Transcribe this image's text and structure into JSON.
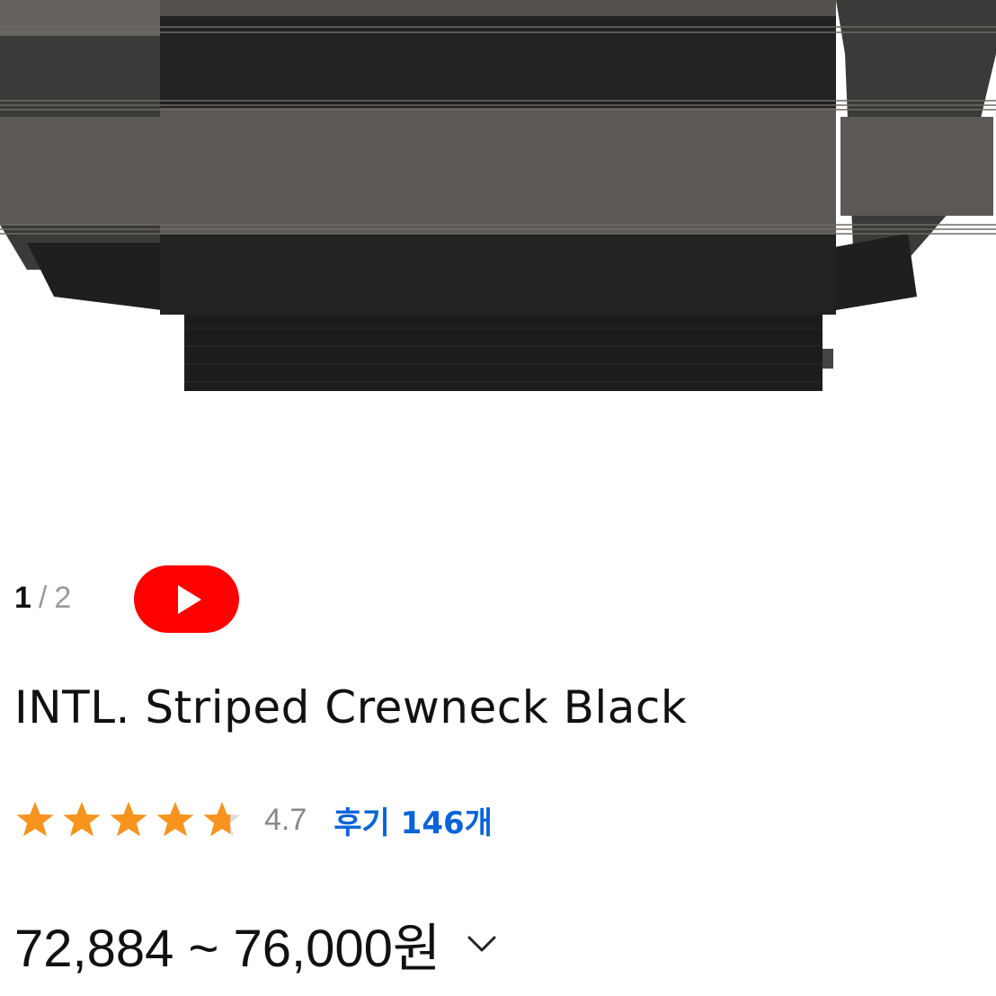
{
  "gallery": {
    "image_alt": "striped crewneck sweatshirt",
    "current_index": "1",
    "separator": "/",
    "total": "2"
  },
  "video_button": {
    "icon": "play-icon",
    "color": "#ff0000"
  },
  "product": {
    "title": "INTL. Striped Crewneck Black",
    "rating": {
      "value": "4.7",
      "score": 4.7,
      "max": 5,
      "star_color": "#f7941d"
    },
    "reviews_label": "후기 146개",
    "price_range": "72,884 ~ 76,000원",
    "price_toggle_icon": "chevron-down-icon"
  }
}
